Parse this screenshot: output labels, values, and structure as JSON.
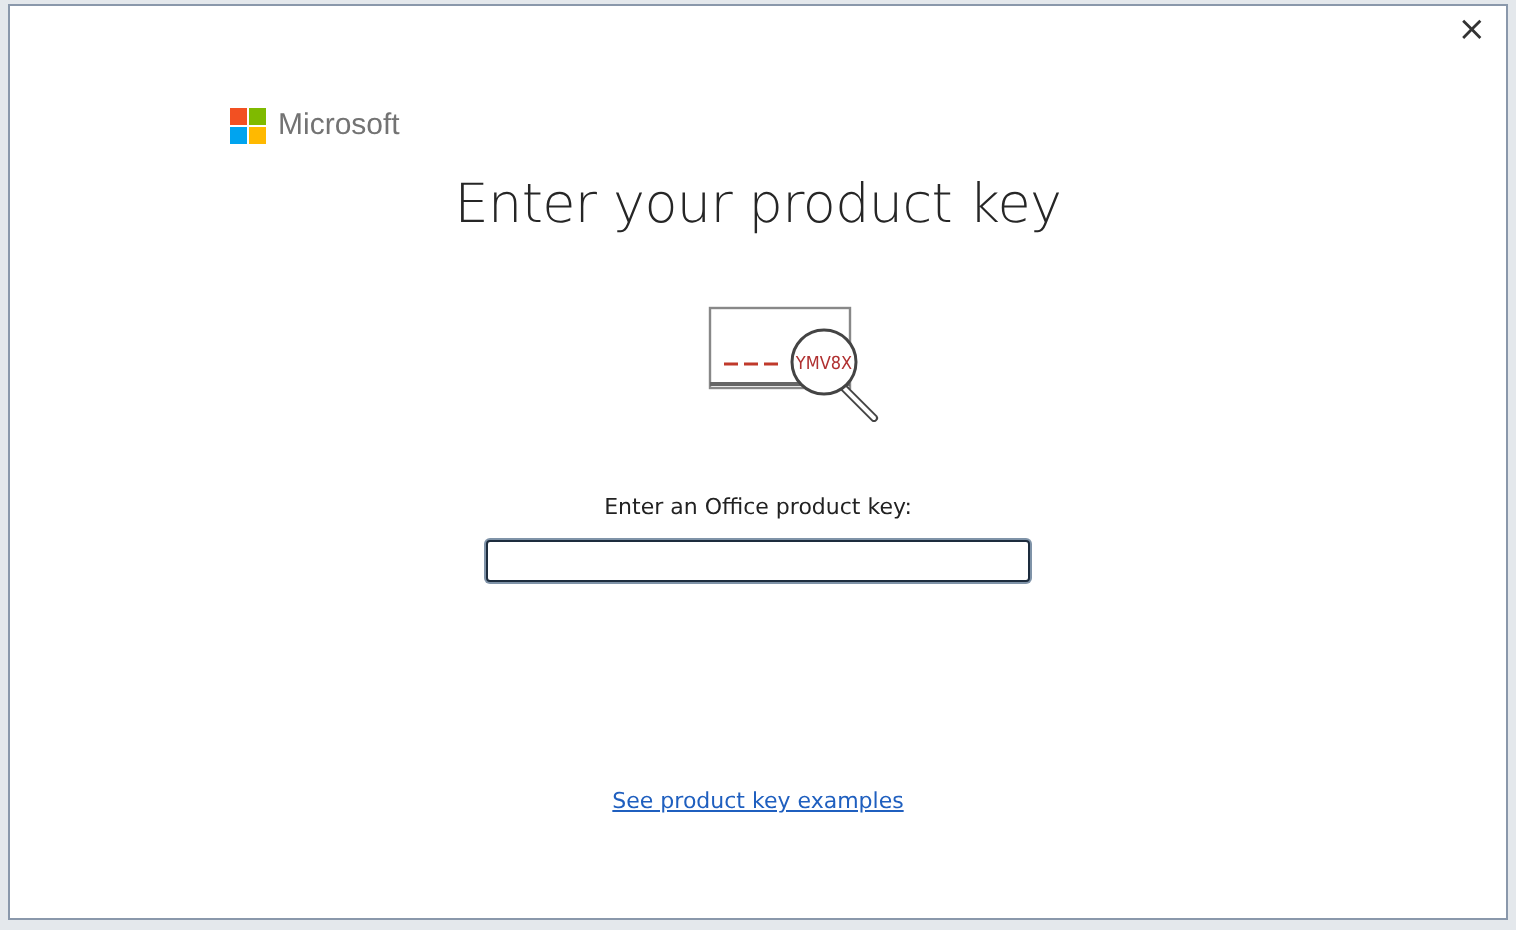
{
  "window": {
    "close": "×"
  },
  "brand": "Microsoft",
  "title": "Enter your product key",
  "illustration": {
    "key_text": "YMV8X"
  },
  "field": {
    "label": "Enter an Office product key:",
    "focused": true
  },
  "link": "See product key examples"
}
